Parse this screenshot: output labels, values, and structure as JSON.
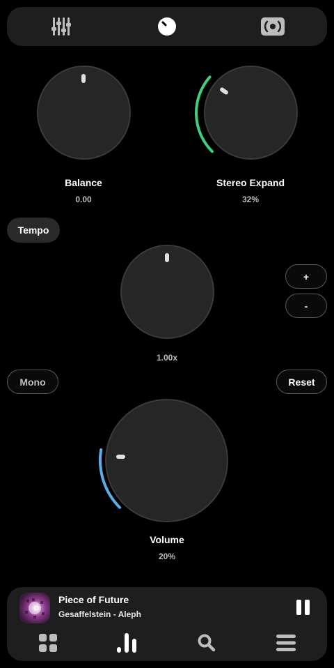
{
  "tabs": [
    {
      "icon": "equalizer-sliders-icon"
    },
    {
      "icon": "knob-icon"
    },
    {
      "icon": "speaker-surround-icon"
    }
  ],
  "balance": {
    "label": "Balance",
    "value": "0.00",
    "level": 0.5
  },
  "stereo": {
    "label": "Stereo Expand",
    "value": "32%",
    "level": 0.32,
    "accent": "#3fcf7e"
  },
  "tempo": {
    "label": "Tempo",
    "value": "1.00x",
    "plus": "+",
    "minus": "-"
  },
  "mono_label": "Mono",
  "reset_label": "Reset",
  "volume": {
    "label": "Volume",
    "value": "20%",
    "level": 0.2,
    "accent": "#5aaee8"
  },
  "player": {
    "title": "Piece of Future",
    "artist": "Gesaffelstein - Aleph",
    "nav": [
      {
        "icon": "grid-icon"
      },
      {
        "icon": "bars-chart-icon"
      },
      {
        "icon": "search-icon"
      },
      {
        "icon": "menu-icon"
      }
    ]
  }
}
